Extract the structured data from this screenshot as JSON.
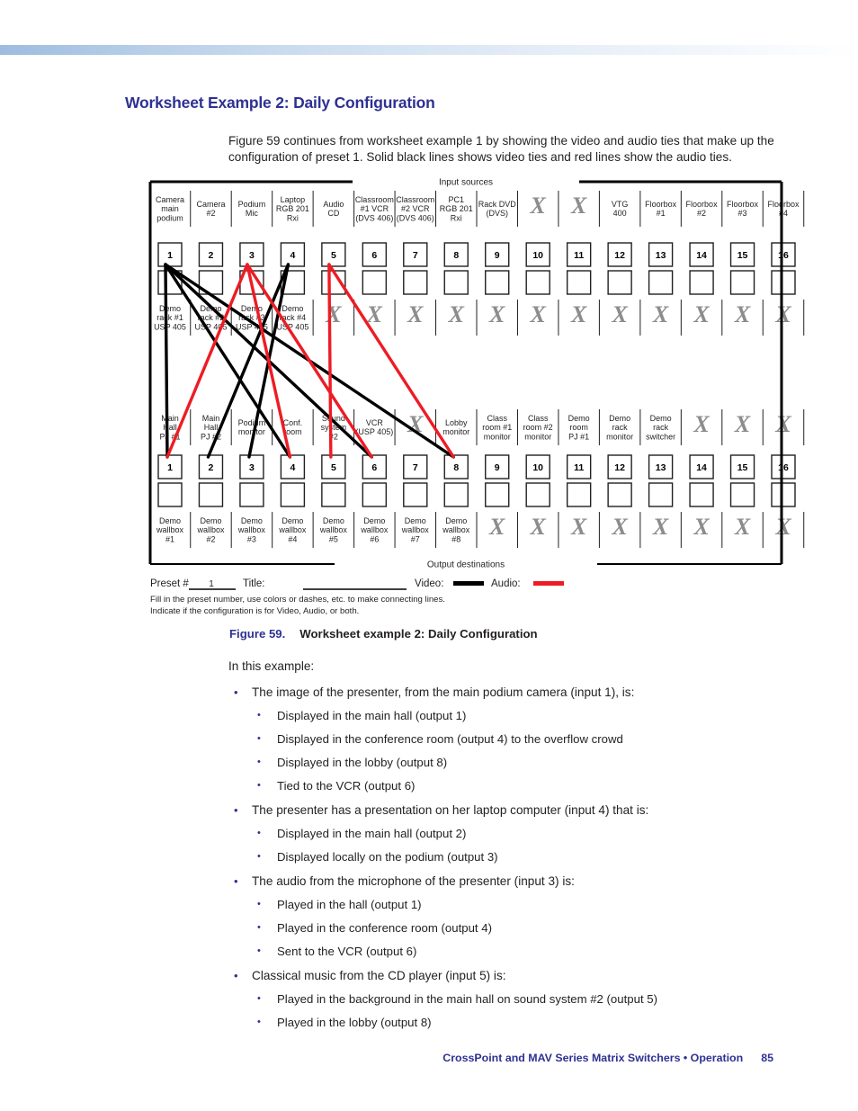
{
  "page": {
    "section_title": "Worksheet Example 2: Daily Configuration",
    "intro": "Figure 59 continues from worksheet example 1 by showing the video and audio ties that make up the configuration of preset 1. Solid black lines shows video ties and red lines show the audio ties.",
    "figure_label": "Figure 59.",
    "figure_title": "Worksheet example 2: Daily Configuration",
    "footer_text": "CrossPoint and MAV Series Matrix Switchers • Operation",
    "page_number": "85"
  },
  "colors": {
    "heading_blue": "#2e3192",
    "video_tie": "#000000",
    "audio_tie": "#ed1c24",
    "x_mark": "#8c8c8c",
    "text": "#231f20"
  },
  "worksheet": {
    "input_bracket_label": "Input sources",
    "output_bracket_label": "Output destinations",
    "input_labels_top": [
      "Camera\nmain\npodium",
      "Camera\n#2",
      "Podium\nMic",
      "Laptop\nRGB 201\nRxi",
      "Audio\nCD",
      "Classroom\n#1 VCR\n(DVS 406)",
      "Classroom\n#2 VCR\n(DVS 406)",
      "PC1\nRGB 201\nRxi",
      "Rack DVD\n(DVS)",
      "X",
      "X",
      "VTG\n400",
      "Floorbox\n#1",
      "Floorbox\n#2",
      "Floorbox\n#3",
      "Floorbox\n#4"
    ],
    "input_labels_bottom": [
      "Demo\nrack #1\nUSP 405",
      "Demo\nrack #2\nUSP 405",
      "Demo\nrack #3\nUSP 405",
      "Demo\nrack #4\nUSP 405",
      "X",
      "X",
      "X",
      "X",
      "X",
      "X",
      "X",
      "X",
      "X",
      "X",
      "X",
      "X"
    ],
    "output_labels_top": [
      "Main\nHall\nPJ #1",
      "Main\nHall\nPJ #2",
      "Podium\nmonitor",
      "Conf.\nroom",
      "Sound\nsystem\n#2",
      "VCR\n(USP 405)",
      "X",
      "Lobby\nmonitor",
      "Class\nroom #1\nmonitor",
      "Class\nroom #2\nmonitor",
      "Demo\nroom\nPJ #1",
      "Demo\nrack\nmonitor",
      "Demo\nrack\nswitcher",
      "X",
      "X",
      "X"
    ],
    "output_labels_bottom": [
      "Demo\nwallbox\n#1",
      "Demo\nwallbox\n#2",
      "Demo\nwallbox\n#3",
      "Demo\nwallbox\n#4",
      "Demo\nwallbox\n#5",
      "Demo\nwallbox\n#6",
      "Demo\nwallbox\n#7",
      "Demo\nwallbox\n#8",
      "X",
      "X",
      "X",
      "X",
      "X",
      "X",
      "X",
      "X"
    ],
    "input_numbers": [
      "1",
      "2",
      "3",
      "4",
      "5",
      "6",
      "7",
      "8",
      "9",
      "10",
      "11",
      "12",
      "13",
      "14",
      "15",
      "16"
    ],
    "output_numbers": [
      "1",
      "2",
      "3",
      "4",
      "5",
      "6",
      "7",
      "8",
      "9",
      "10",
      "11",
      "12",
      "13",
      "14",
      "15",
      "16"
    ],
    "legend": {
      "preset_label": "Preset #",
      "preset_value": "1",
      "title_label": "Title:",
      "title_value": "",
      "video_label": "Video:",
      "audio_label": "Audio:",
      "note_line_1": "Fill in the preset number, use colors or dashes, etc. to make connecting lines.",
      "note_line_2": "Indicate if the configuration is for Video, Audio, or both."
    }
  },
  "chart_data": {
    "type": "diagram",
    "title": "Worksheet example 2: Daily Configuration",
    "legend": [
      {
        "name": "Video tie",
        "color": "#000000",
        "style": "solid black line"
      },
      {
        "name": "Audio tie",
        "color": "#ed1c24",
        "style": "solid red line"
      }
    ],
    "video_ties": [
      {
        "input": 1,
        "output": 1
      },
      {
        "input": 1,
        "output": 4
      },
      {
        "input": 1,
        "output": 6
      },
      {
        "input": 1,
        "output": 8
      },
      {
        "input": 4,
        "output": 2
      },
      {
        "input": 4,
        "output": 3
      }
    ],
    "audio_ties": [
      {
        "input": 3,
        "output": 1
      },
      {
        "input": 3,
        "output": 4
      },
      {
        "input": 3,
        "output": 6
      },
      {
        "input": 5,
        "output": 5
      },
      {
        "input": 5,
        "output": 8
      }
    ]
  },
  "body": {
    "lead": "In this example:",
    "items": [
      {
        "text": "The image of the presenter, from the main podium camera (input 1), is:",
        "subitems": [
          "Displayed in the main hall (output 1)",
          "Displayed in the conference room (output 4) to the overflow crowd",
          "Displayed in the lobby (output 8)",
          "Tied to the VCR (output 6)"
        ]
      },
      {
        "text": "The presenter has a presentation on her laptop computer (input 4) that is:",
        "subitems": [
          "Displayed in the main hall (output 2)",
          "Displayed locally on the podium (output 3)"
        ]
      },
      {
        "text": "The audio from the microphone of the presenter (input 3) is:",
        "subitems": [
          "Played in the hall (output 1)",
          "Played in the conference room (output 4)",
          "Sent to the VCR (output 6)"
        ]
      },
      {
        "text": "Classical music from the CD player (input 5) is:",
        "subitems": [
          "Played in the background in the main hall on sound system #2 (output 5)",
          "Played in the lobby (output 8)"
        ]
      }
    ]
  }
}
